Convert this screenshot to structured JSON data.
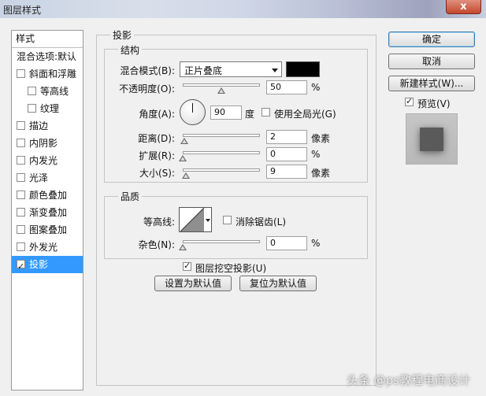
{
  "window": {
    "title": "图层样式",
    "close_glyph": "x"
  },
  "sidebar": {
    "header": "样式",
    "items": [
      {
        "label": "混合选项:默认",
        "checkbox": false,
        "checked": false,
        "sub": false
      },
      {
        "label": "斜面和浮雕",
        "checkbox": true,
        "checked": false,
        "sub": false
      },
      {
        "label": "等高线",
        "checkbox": true,
        "checked": false,
        "sub": true
      },
      {
        "label": "纹理",
        "checkbox": true,
        "checked": false,
        "sub": true
      },
      {
        "label": "描边",
        "checkbox": true,
        "checked": false,
        "sub": false
      },
      {
        "label": "内阴影",
        "checkbox": true,
        "checked": false,
        "sub": false
      },
      {
        "label": "内发光",
        "checkbox": true,
        "checked": false,
        "sub": false
      },
      {
        "label": "光泽",
        "checkbox": true,
        "checked": false,
        "sub": false
      },
      {
        "label": "颜色叠加",
        "checkbox": true,
        "checked": false,
        "sub": false
      },
      {
        "label": "渐变叠加",
        "checkbox": true,
        "checked": false,
        "sub": false
      },
      {
        "label": "图案叠加",
        "checkbox": true,
        "checked": false,
        "sub": false
      },
      {
        "label": "外发光",
        "checkbox": true,
        "checked": false,
        "sub": false
      },
      {
        "label": "投影",
        "checkbox": true,
        "checked": true,
        "sub": false,
        "selected": true
      }
    ]
  },
  "panel": {
    "title": "投影",
    "structure": {
      "title": "结构",
      "blend_mode_label": "混合模式(B):",
      "blend_mode_value": "正片叠底",
      "shadow_color": "#000000",
      "opacity_label": "不透明度(O):",
      "opacity_value": "50",
      "opacity_fraction": 0.5,
      "opacity_unit": "%",
      "angle_label": "角度(A):",
      "angle_value": "90",
      "angle_unit": "度",
      "global_light_label": "使用全局光(G)",
      "global_light_checked": false,
      "distance_label": "距离(D):",
      "distance_value": "2",
      "distance_fraction": 0.02,
      "distance_unit": "像素",
      "spread_label": "扩展(R):",
      "spread_value": "0",
      "spread_fraction": 0.0,
      "spread_unit": "%",
      "size_label": "大小(S):",
      "size_value": "9",
      "size_fraction": 0.04,
      "size_unit": "像素"
    },
    "quality": {
      "title": "品质",
      "contour_label": "等高线:",
      "antialias_label": "消除锯齿(L)",
      "antialias_checked": false,
      "noise_label": "杂色(N):",
      "noise_value": "0",
      "noise_fraction": 0.0,
      "noise_unit": "%"
    },
    "knockout_label": "图层挖空投影(U)",
    "knockout_checked": true,
    "make_default_label": "设置为默认值",
    "reset_default_label": "复位为默认值"
  },
  "actions": {
    "ok_label": "确定",
    "cancel_label": "取消",
    "new_style_label": "新建样式(W)...",
    "preview_label": "预览(V)",
    "preview_checked": true
  },
  "watermark": "头条 @ps教程电商设计"
}
